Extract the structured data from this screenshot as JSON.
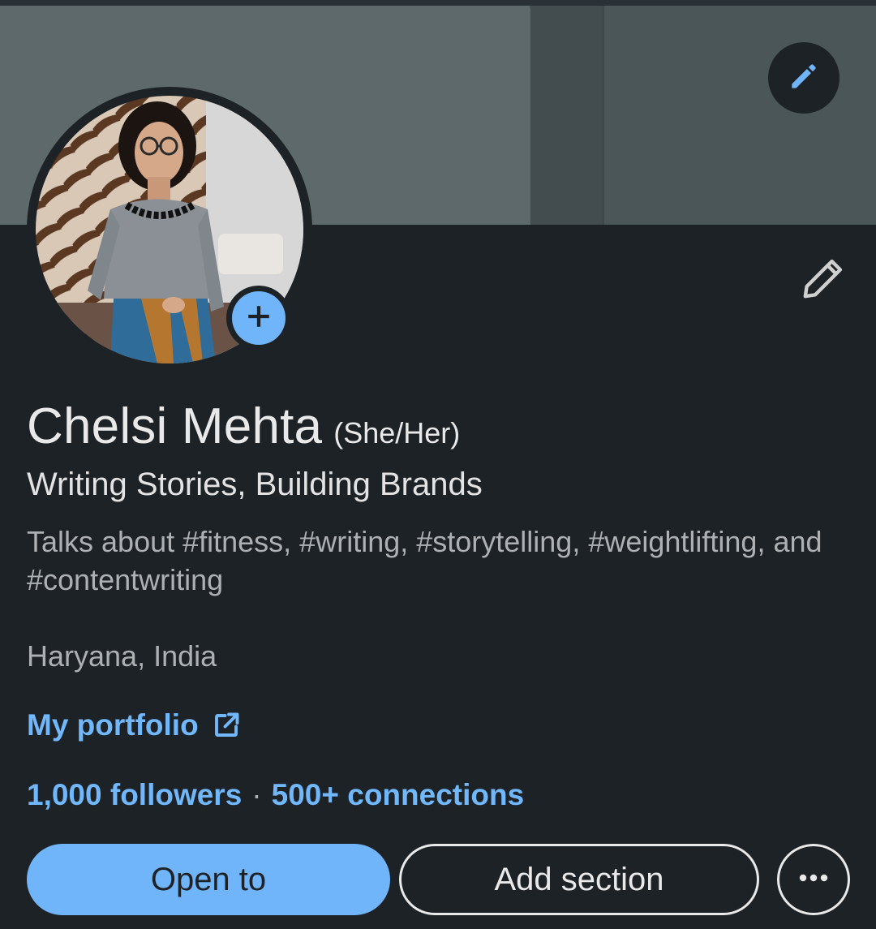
{
  "profile": {
    "name": "Chelsi Mehta",
    "pronouns": "(She/Her)",
    "headline": "Writing Stories, Building Brands",
    "talks_about": "Talks about #fitness, #writing, #storytelling, #weightlifting, and #contentwriting",
    "location": "Haryana, India",
    "portfolio_label": "My portfolio",
    "followers": "1,000 followers",
    "separator": "·",
    "connections": "500+ connections"
  },
  "actions": {
    "open_to": "Open to",
    "add_section": "Add section"
  },
  "icons": {
    "banner_edit": "pencil-icon",
    "intro_edit": "pencil-icon",
    "add_photo": "plus-icon",
    "external_link": "external-link-icon",
    "more": "more-horizontal-icon"
  },
  "colors": {
    "background": "#1d2226",
    "accent": "#70b5f9",
    "link": "#71b7fb",
    "text_primary": "#e9e9e9",
    "text_secondary": "#aeb1b3"
  }
}
